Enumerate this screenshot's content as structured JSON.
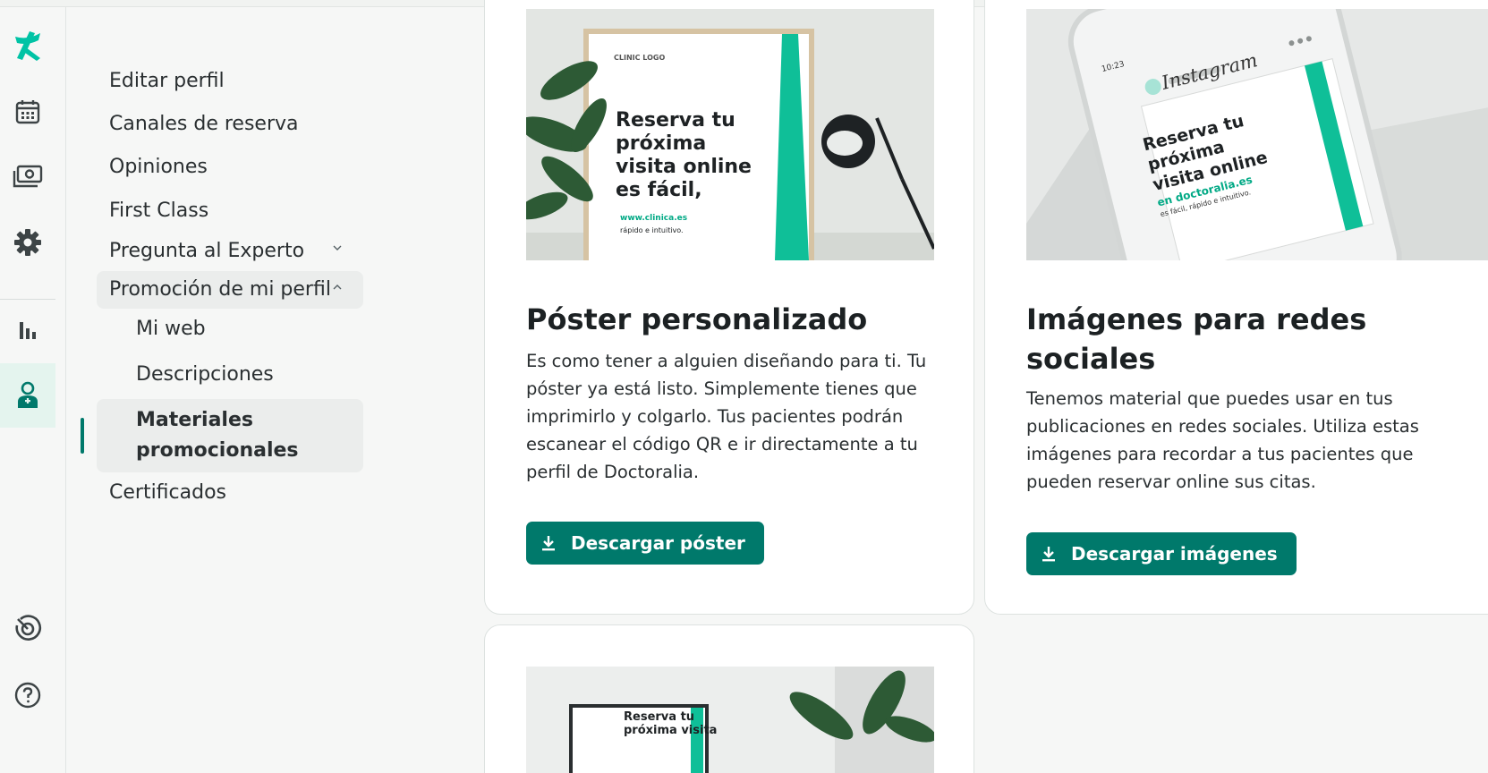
{
  "colors": {
    "accent": "#00796b",
    "accent_light": "#e4f4ee",
    "brand": "#00c3a5"
  },
  "rail": {
    "items": [
      {
        "icon": "doctoralia-logo-icon"
      },
      {
        "icon": "calendar-icon"
      },
      {
        "icon": "money-icon"
      },
      {
        "icon": "gear-icon"
      },
      {
        "icon": "bar-chart-icon"
      },
      {
        "icon": "doctor-profile-icon"
      },
      {
        "icon": "target-icon"
      },
      {
        "icon": "help-icon"
      }
    ]
  },
  "subnav": {
    "edit_profile": "Editar perfil",
    "booking_channels": "Canales de reserva",
    "reviews": "Opiniones",
    "first_class": "First Class",
    "ask_expert": "Pregunta al Experto",
    "promotion": "Promoción de mi perfil",
    "my_web": "Mi web",
    "descriptions": "Descripciones",
    "materials_line1": "Materiales",
    "materials_line2": "promocionales",
    "certificates": "Certificados"
  },
  "cards": {
    "poster": {
      "title": "Póster personalizado",
      "text": [
        "Es como tener a alguien diseñando para ti. Tu",
        "póster ya está listo. Simplemente tienes que",
        "imprimirlo y colgarlo. Tus pacientes podrán",
        "escanear el código QR e ir directamente a tu",
        "perfil de Doctoralia."
      ],
      "button": "Descargar póster",
      "img": {
        "logo": "CLINIC LOGO",
        "l1": "Reserva tu",
        "l2": "próxima",
        "l3": "visita online",
        "l4": "es fácil,",
        "url": "www.clinica.es",
        "tag": "rápido e intuitivo."
      }
    },
    "social": {
      "title_line1": "Imágenes para redes",
      "title_line2": "sociales",
      "text": [
        "Tenemos material que puedes usar en tus",
        "publicaciones en redes sociales. Utiliza estas",
        "imágenes para recordar a tus pacientes que",
        "pueden reservar online sus citas."
      ],
      "button": "Descargar imágenes",
      "img": {
        "time": "10:23",
        "app": "Instagram",
        "l1": "Reserva tu",
        "l2": "próxima",
        "l3": "visita online",
        "l4": "en doctoralia.es",
        "tag": "es fácil, rápido e intuitivo."
      }
    },
    "third": {
      "img": {
        "l1": "Reserva tu",
        "l2": "próxima visita"
      }
    }
  }
}
